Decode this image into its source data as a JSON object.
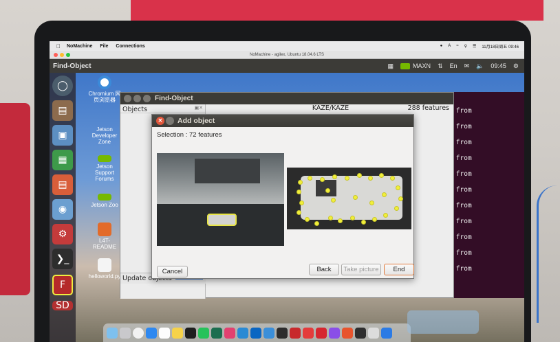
{
  "mac_menubar": {
    "app": "NoMachine",
    "menus": [
      "File",
      "Connections"
    ],
    "datetime": "11月18日周五  09:46"
  },
  "nomachine": {
    "title": "NoMachine - agilex, Ubuntu 18.04.6 LTS"
  },
  "ubuntu_panel": {
    "active_app": "Find-Object",
    "power_mode": "MAXN",
    "keyboard": "En",
    "clock": "09:45"
  },
  "desktop_icons": [
    "Chromium 网页浏览器",
    "Jetson Developer Zone",
    "Jetson Support Forums",
    "Jetson Zoo",
    "L4T-README",
    "helloworld.py"
  ],
  "find_object": {
    "title": "Find-Object",
    "objects_panel": "Objects",
    "detector": "KAZE/KAZE",
    "features": "288 features",
    "update_objects": "Update objects"
  },
  "terminal": {
    "line": "tors extracted from",
    "line_count": 11
  },
  "dialog": {
    "title": "Add object",
    "selection": "Selection : 72 features",
    "cancel": "Cancel",
    "back": "Back",
    "take_picture": "Take picture",
    "end": "End"
  },
  "colors": {
    "accent_yellow": "#f1ef3b",
    "ubuntu_panel": "#3c3b37",
    "terminal_bg": "#330d26",
    "nvidia_green": "#76b900"
  }
}
